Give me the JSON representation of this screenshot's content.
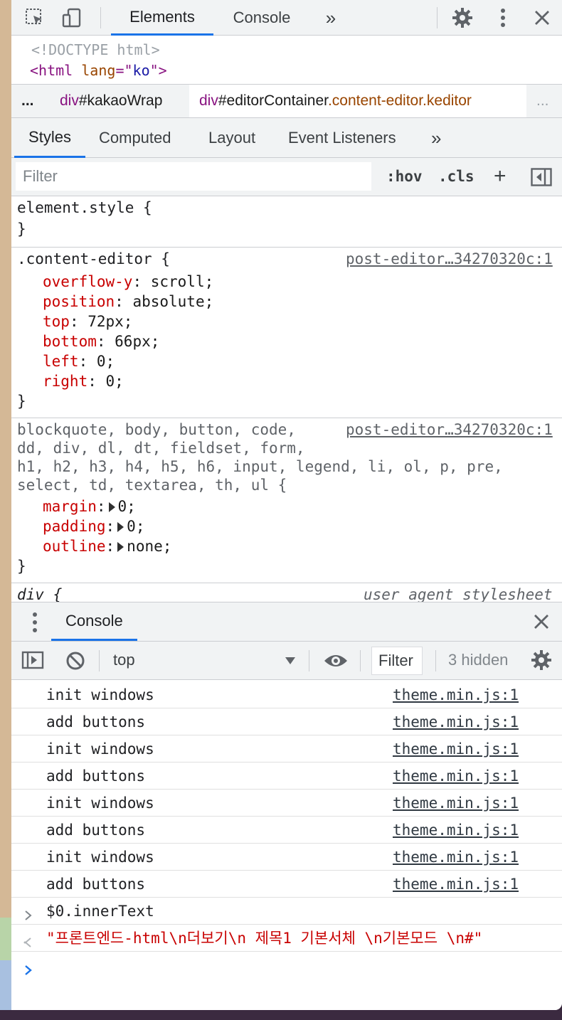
{
  "colors": {
    "accent": "#1a73e8",
    "tag": "#881280",
    "attr_name": "#994500",
    "attr_value": "#1a1aa6",
    "css_property": "#c80000",
    "error_red": "#c80000"
  },
  "toolbar": {
    "icons": [
      "inspect-icon",
      "device-toolbar-icon",
      "more-tabs-icon",
      "gear-icon",
      "kebab-menu-icon",
      "close-icon"
    ],
    "tabs": [
      {
        "label": "Elements",
        "active": true
      },
      {
        "label": "Console",
        "active": false
      }
    ],
    "more_tabs": "»"
  },
  "dom": {
    "doctype": "<!DOCTYPE html>",
    "html_lt": "<",
    "html_tag": "html",
    "html_attr": "lang",
    "html_eq": "=\"",
    "html_val": "ko",
    "html_end": "\">"
  },
  "breadcrumbs": {
    "ellipsis_left": "...",
    "items": [
      {
        "tag": "div",
        "id": "#kakaoWrap",
        "classes": ""
      },
      {
        "tag": "div",
        "id": "#editorContainer",
        "classes": ".content-editor.keditor"
      }
    ],
    "ellipsis_right": "..."
  },
  "subtabs": {
    "tabs": [
      {
        "label": "Styles",
        "active": true
      },
      {
        "label": "Computed",
        "active": false
      },
      {
        "label": "Layout",
        "active": false
      },
      {
        "label": "Event Listeners",
        "active": false
      }
    ],
    "more": "»"
  },
  "styles_filter": {
    "placeholder": "Filter",
    "hov": ":hov",
    "cls": ".cls",
    "plus": "+"
  },
  "rules": {
    "element_style": {
      "open": "element.style {",
      "close": "}"
    },
    "content_editor": {
      "selector": ".content-editor {",
      "source": "post-editor…34270320c:1",
      "props": [
        {
          "name": "overflow-y",
          "value": "scroll;"
        },
        {
          "name": "position",
          "value": "absolute;"
        },
        {
          "name": "top",
          "value": "72px;"
        },
        {
          "name": "bottom",
          "value": "66px;"
        },
        {
          "name": "left",
          "value": "0;"
        },
        {
          "name": "right",
          "value": "0;"
        }
      ],
      "close": "}"
    },
    "reset": {
      "selector_lines": [
        "blockquote, body, button, code,",
        "dd, div, dl, dt, fieldset, form,",
        "h1, h2, h3, h4, h5, h6, input, legend, li, ol, p, pre,",
        "select, td, textarea, th, ul {"
      ],
      "source": "post-editor…34270320c:1",
      "props": [
        {
          "name": "margin",
          "value": "0;"
        },
        {
          "name": "padding",
          "value": "0;"
        },
        {
          "name": "outline",
          "value": "none;"
        }
      ],
      "close": "}"
    },
    "div_rule": {
      "selector": "div {",
      "source": "user agent stylesheet"
    }
  },
  "drawer": {
    "title": "Console"
  },
  "console_toolbar": {
    "context": "top",
    "filter_label": "Filter",
    "hidden": "3 hidden"
  },
  "messages": [
    {
      "text": "init windows",
      "source": "theme.min.js:1"
    },
    {
      "text": "add buttons",
      "source": "theme.min.js:1"
    },
    {
      "text": "init windows",
      "source": "theme.min.js:1"
    },
    {
      "text": "add buttons",
      "source": "theme.min.js:1"
    },
    {
      "text": "init windows",
      "source": "theme.min.js:1"
    },
    {
      "text": "add buttons",
      "source": "theme.min.js:1"
    },
    {
      "text": "init windows",
      "source": "theme.min.js:1"
    },
    {
      "text": "add buttons",
      "source": "theme.min.js:1"
    }
  ],
  "command": {
    "input": "$0.innerText",
    "result": "\"프론트엔드-html\\n더보기\\n 제목1 기본서체 \\n기본모드 \\n#\""
  }
}
